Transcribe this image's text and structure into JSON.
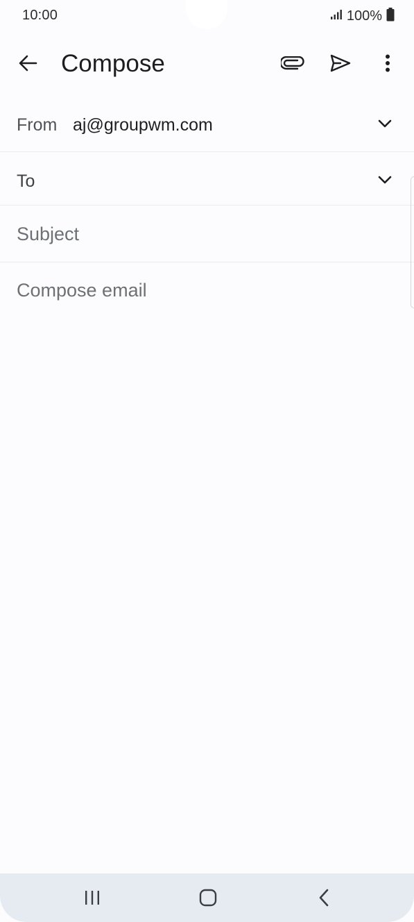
{
  "status_bar": {
    "time": "10:00",
    "battery": "100%"
  },
  "app_bar": {
    "title": "Compose",
    "icons": [
      "back-arrow-icon",
      "attachment-icon",
      "send-icon",
      "more-vert-icon"
    ]
  },
  "from": {
    "label": "From",
    "value": "aj@groupwm.com"
  },
  "to": {
    "label": "To"
  },
  "subject": {
    "placeholder": "Subject"
  },
  "body": {
    "placeholder": "Compose email"
  },
  "nav_bar": {
    "icons": [
      "recent-apps-icon",
      "home-icon",
      "back-icon"
    ]
  },
  "colors": {
    "background": "#fcfcfe",
    "nav_bar": "#e6ebf2",
    "text_primary": "#1f1f22",
    "text_secondary": "#6d7075"
  }
}
